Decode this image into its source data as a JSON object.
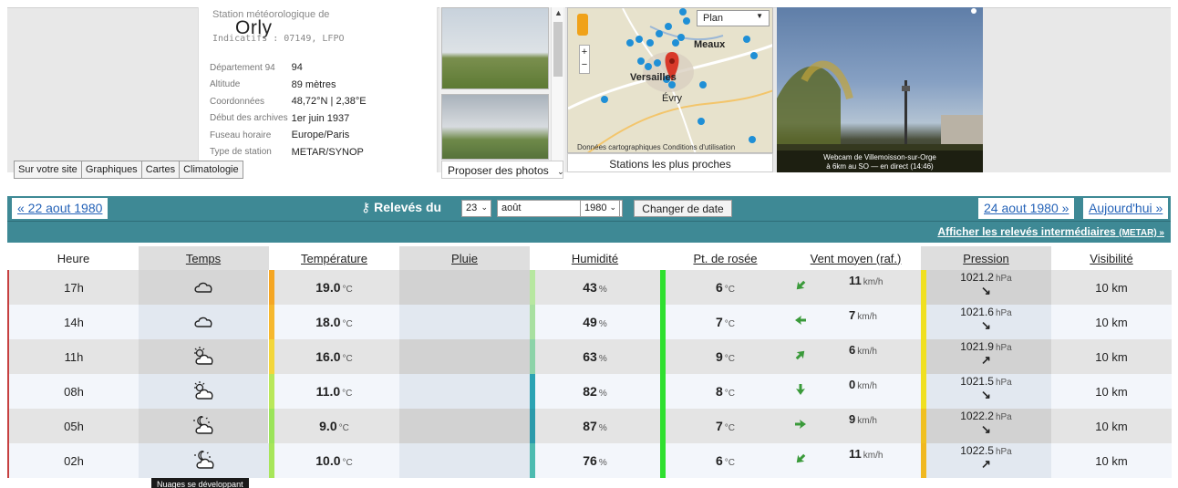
{
  "station": {
    "label": "Station météorologique de",
    "name": "Orly",
    "codes": "Indicatifs : 07149, LFPO",
    "info": [
      {
        "key": "Département 94",
        "value": "94"
      },
      {
        "key": "Altitude",
        "value": "89 mètres"
      },
      {
        "key": "Coordonnées",
        "value": "48,72°N | 2,38°E"
      },
      {
        "key": "Début des archives",
        "value": "1er juin 1937"
      },
      {
        "key": "Fuseau horaire",
        "value": "Europe/Paris"
      },
      {
        "key": "Type de station",
        "value": "METAR/SYNOP"
      }
    ]
  },
  "tabs": [
    "Sur votre site",
    "Graphiques",
    "Cartes",
    "Climatologie"
  ],
  "photos": {
    "link": "Proposer des photos"
  },
  "map": {
    "type": "Plan",
    "caption": "Stations les plus proches",
    "attribution": "Données cartographiques   Conditions d'utilisation",
    "places": [
      "Meaux",
      "Versailles",
      "Évry",
      "P"
    ]
  },
  "webcam": {
    "caption": "Webcam de Villemoisson-sur-Orge",
    "sub": "à 6km au SO — en direct (14:46)"
  },
  "nav": {
    "prev": "« 22 aout 1980",
    "next": "24 aout 1980 »",
    "today": "Aujourd'hui »",
    "releves": "Relevés du",
    "day": "23",
    "month": "août",
    "year": "1980",
    "change": "Changer de date",
    "metar": "Afficher les relevés intermédiaires",
    "metar_small": "(METAR) »"
  },
  "headers": [
    "Heure",
    "Temps",
    "Température",
    "Pluie",
    "Humidité",
    "Pt. de rosée",
    "Vent moyen (raf.)",
    "Pression",
    "Visibilité"
  ],
  "rows": [
    {
      "heure": "17h",
      "temp": "19.0",
      "hum": "43",
      "rosee": "6",
      "vent": "11",
      "pression": "1021.2",
      "trend": "↘",
      "vis": "10 km",
      "sky": "cloud",
      "temp_color": "#f5a623",
      "hum_color": "#b7e7a0",
      "rosee_color": "#2fe02f",
      "pres_color": "#f0e020",
      "wind_dir": "SW"
    },
    {
      "heure": "14h",
      "temp": "18.0",
      "hum": "49",
      "rosee": "7",
      "vent": "7",
      "pression": "1021.6",
      "trend": "↘",
      "vis": "10 km",
      "sky": "cloud",
      "temp_color": "#f6b82e",
      "hum_color": "#a8e0a0",
      "rosee_color": "#2fe02f",
      "pres_color": "#f0e020",
      "wind_dir": "W"
    },
    {
      "heure": "11h",
      "temp": "16.0",
      "hum": "63",
      "rosee": "9",
      "vent": "6",
      "pression": "1021.9",
      "trend": "↗",
      "vis": "10 km",
      "sky": "sun-cloud",
      "temp_color": "#f3d63a",
      "hum_color": "#8cd3a8",
      "rosee_color": "#2fe02f",
      "pres_color": "#f0e020",
      "wind_dir": "NE"
    },
    {
      "heure": "08h",
      "temp": "11.0",
      "hum": "82",
      "rosee": "8",
      "vent": "0",
      "pression": "1021.5",
      "trend": "↘",
      "vis": "10 km",
      "sky": "sun-cloud",
      "temp_color": "#b9e85a",
      "hum_color": "#2ba3b3",
      "rosee_color": "#2fe02f",
      "pres_color": "#f0e020",
      "wind_dir": "S"
    },
    {
      "heure": "05h",
      "temp": "9.0",
      "hum": "87",
      "rosee": "7",
      "vent": "9",
      "pression": "1022.2",
      "trend": "↘",
      "vis": "10 km",
      "sky": "moon-cloud",
      "temp_color": "#9be45a",
      "hum_color": "#2b9aaa",
      "rosee_color": "#2fe02f",
      "pres_color": "#f0c020",
      "wind_dir": "E"
    },
    {
      "heure": "02h",
      "temp": "10.0",
      "hum": "76",
      "rosee": "6",
      "vent": "11",
      "pression": "1022.5",
      "trend": "↗",
      "vis": "10 km",
      "sky": "moon-cloud",
      "temp_color": "#a7e65a",
      "hum_color": "#4dbbb0",
      "rosee_color": "#2fe02f",
      "pres_color": "#f0b820",
      "wind_dir": "SW"
    }
  ],
  "units": {
    "temp": "°C",
    "pct": "%",
    "wind": "km/h",
    "pres": "hPa"
  },
  "tooltip": "Nuages se développant"
}
